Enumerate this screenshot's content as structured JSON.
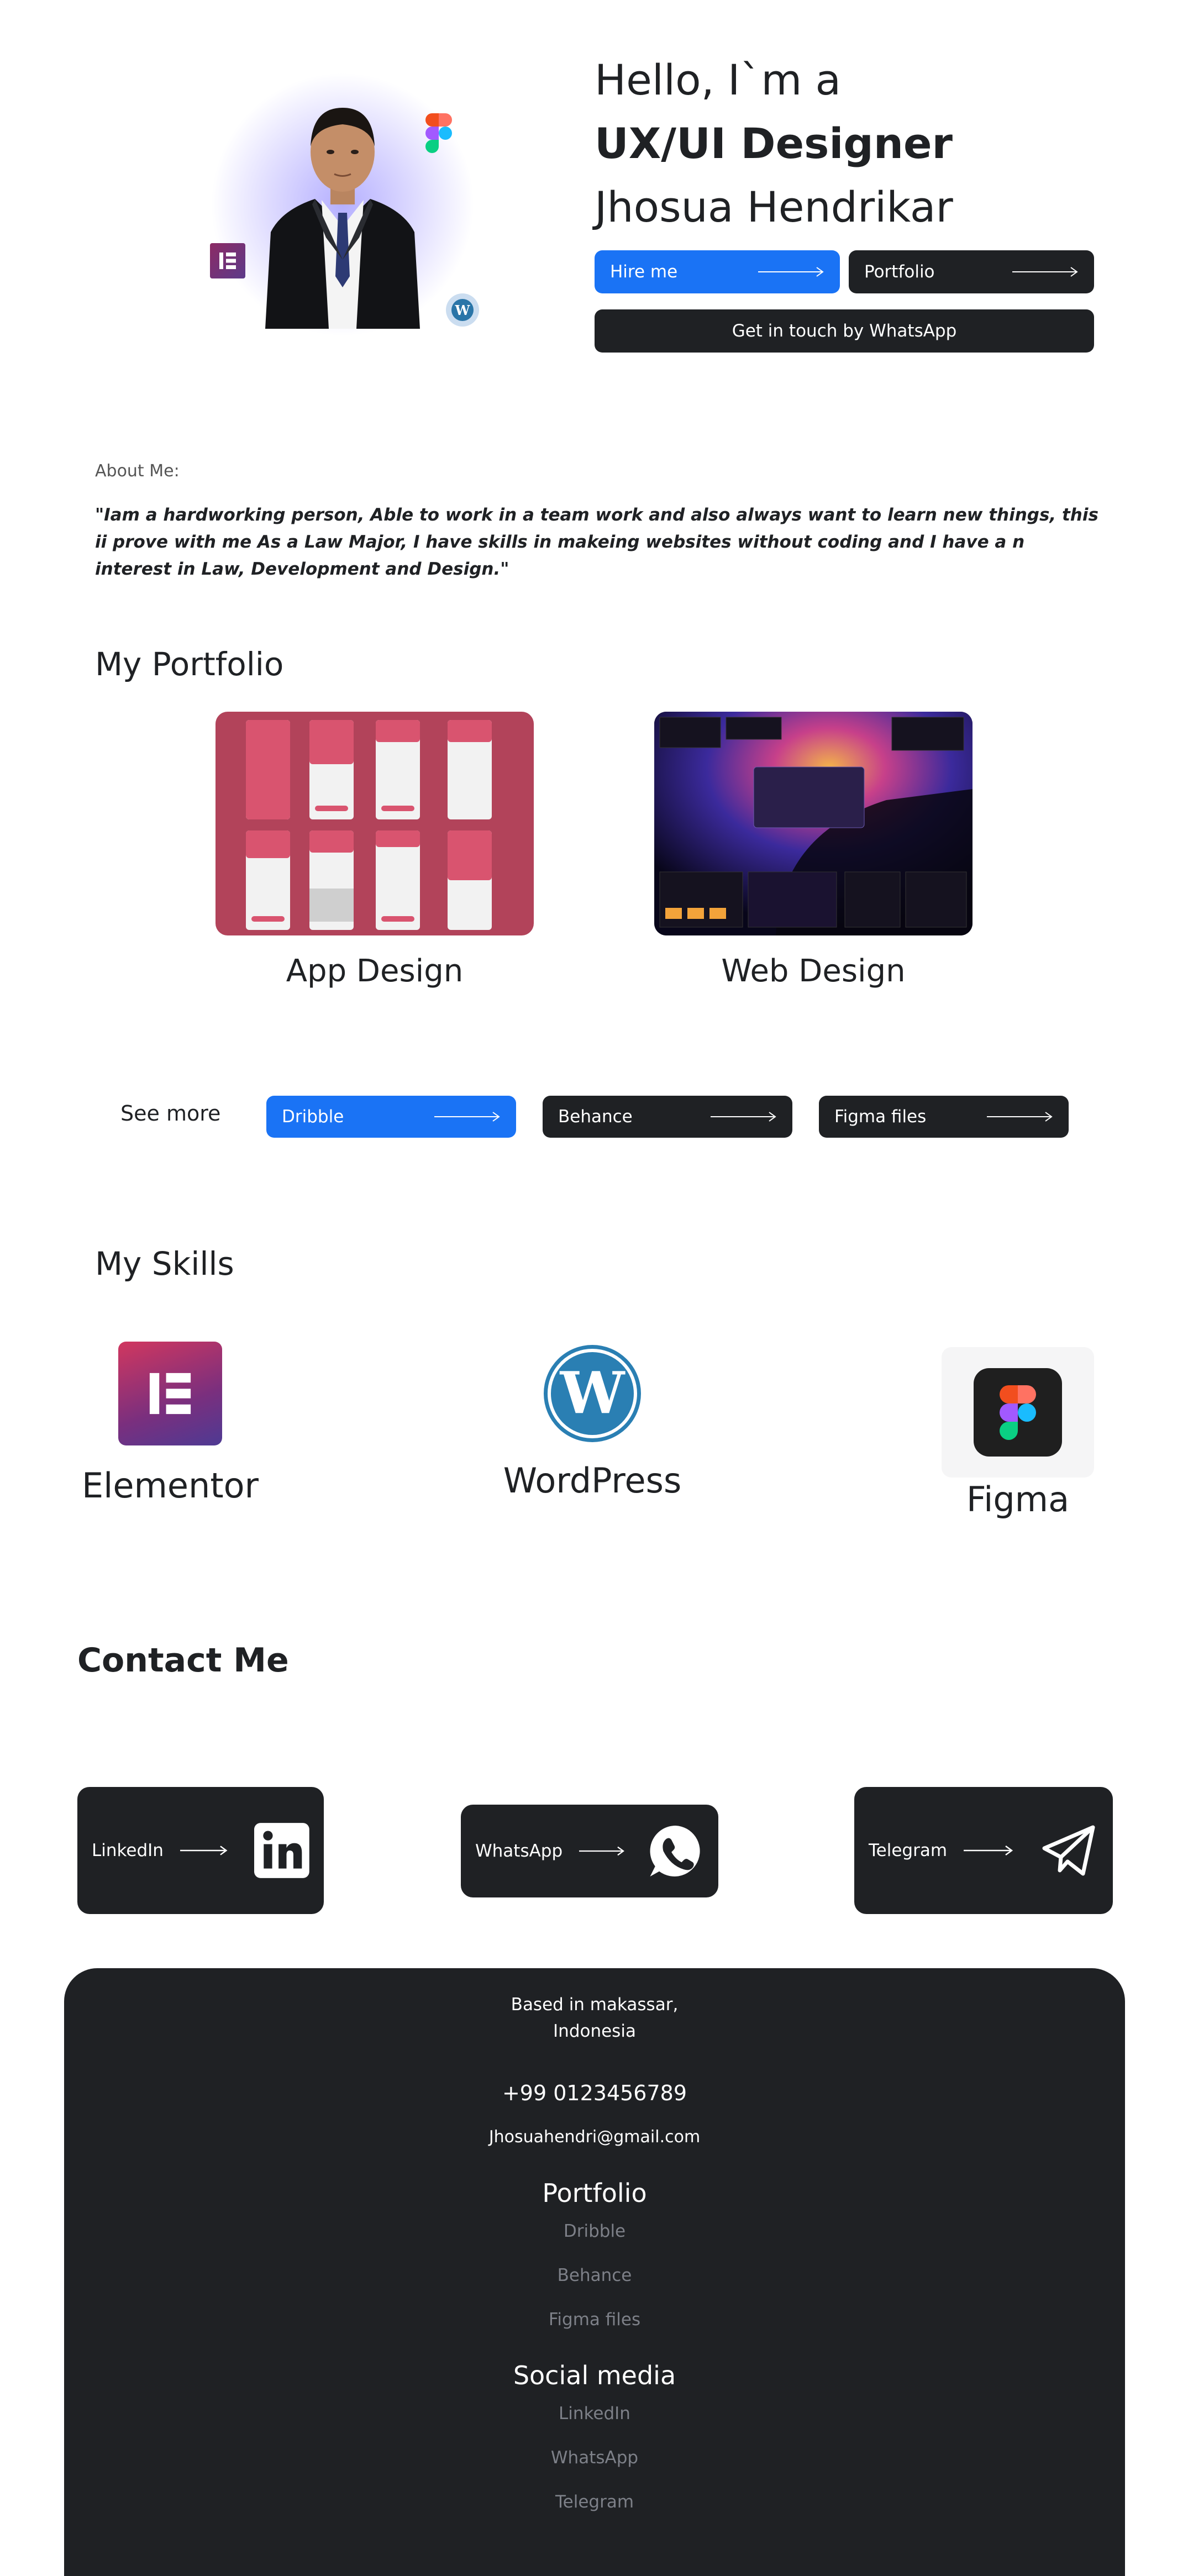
{
  "hero": {
    "greeting": "Hello, I`m a",
    "role": "UX/UI Designer",
    "name": "Jhosua Hendrikar",
    "hire_label": "Hire me",
    "portfolio_label": "Portfolio",
    "whatsapp_label": "Get in touch by WhatsApp"
  },
  "about": {
    "label": "About Me:",
    "quote": "\"Iam a hardworking person, Able to work in a team work and also always want to learn new things, this ii prove with me As a Law Major, I have skills in makeing websites without coding and I have a n interest in Law, Development and Design.\""
  },
  "portfolio": {
    "title": "My Portfolio",
    "items": [
      {
        "label": "App Design"
      },
      {
        "label": "Web Design"
      }
    ],
    "see_more": "See more",
    "links": [
      "Dribble",
      "Behance",
      "Figma files"
    ]
  },
  "skills": {
    "title": "My Skills",
    "items": [
      {
        "label": "Elementor",
        "icon": "elementor-icon"
      },
      {
        "label": "WordPress",
        "icon": "wordpress-icon"
      },
      {
        "label": "Figma",
        "icon": "figma-icon"
      }
    ]
  },
  "contact": {
    "title": "Contact Me",
    "items": [
      {
        "label": "LinkedIn",
        "icon": "linkedin-icon"
      },
      {
        "label": "WhatsApp",
        "icon": "whatsapp-icon"
      },
      {
        "label": "Telegram",
        "icon": "telegram-icon"
      }
    ]
  },
  "footer": {
    "based_line1": "Based in makassar,",
    "based_line2": "Indonesia",
    "phone": "+99 0123456789",
    "email": "Jhosuahendri@gmail.com",
    "portfolio_title": "Portfolio",
    "portfolio_links": [
      "Dribble",
      "Behance",
      "Figma files"
    ],
    "social_title": "Social media",
    "social_links": [
      "LinkedIn",
      "WhatsApp",
      "Telegram"
    ]
  },
  "colors": {
    "accent_blue": "#1a73f5",
    "dark": "#1f2124",
    "muted": "#7d8088"
  }
}
